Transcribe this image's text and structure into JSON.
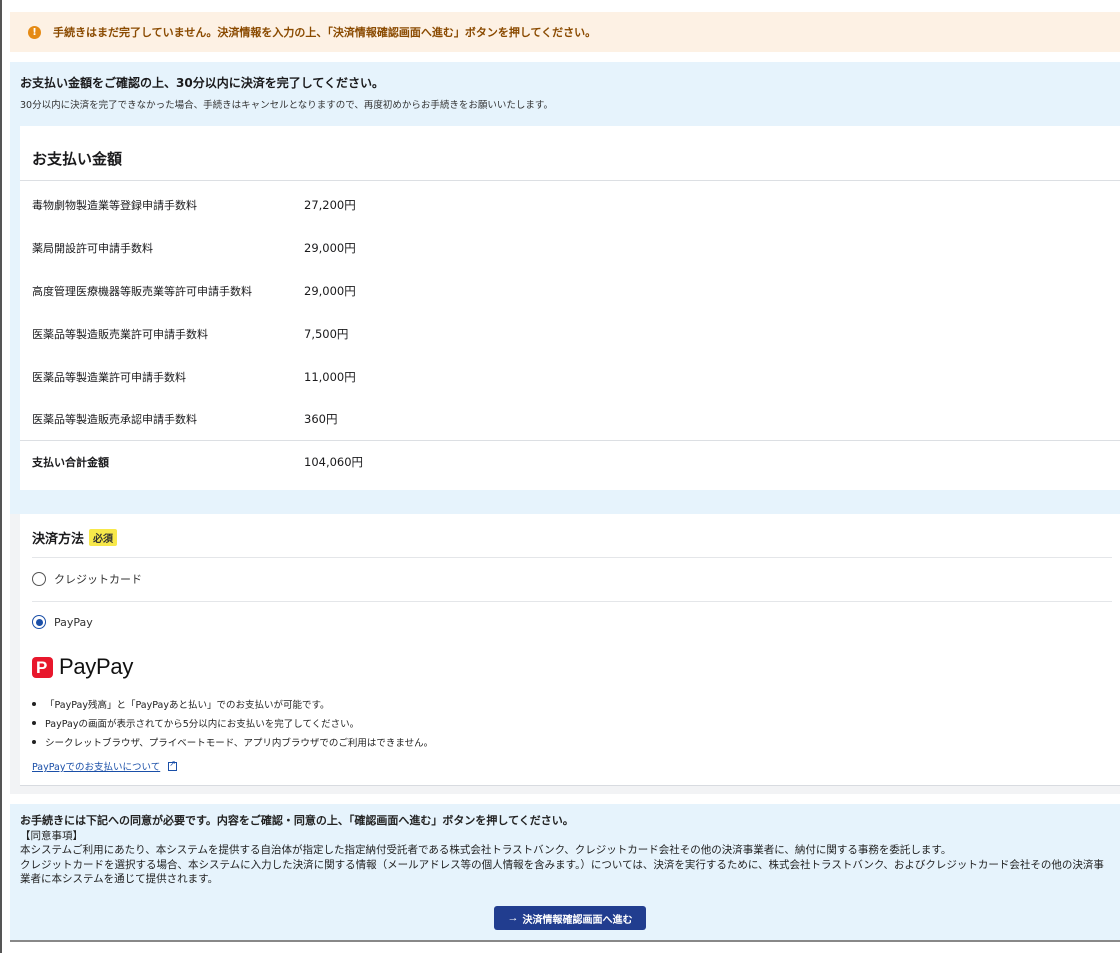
{
  "alert": {
    "icon": "exclamation-icon",
    "text": "手続きはまだ完了していません。決済情報を入力の上、「決済情報確認画面へ進む」ボタンを押してください。"
  },
  "notice": {
    "heading": "お支払い金額をご確認の上、30分以内に決済を完了してください。",
    "sub": "30分以内に決済を完了できなかった場合、手続きはキャンセルとなりますので、再度初めからお手続きをお願いいたします。"
  },
  "payment": {
    "title": "お支払い金額",
    "items": [
      {
        "name": "毒物劇物製造業等登録申請手数料",
        "amount": "27,200円"
      },
      {
        "name": "薬局開設許可申請手数料",
        "amount": "29,000円"
      },
      {
        "name": "高度管理医療機器等販売業等許可申請手数料",
        "amount": "29,000円"
      },
      {
        "name": "医薬品等製造販売業許可申請手数料",
        "amount": "7,500円"
      },
      {
        "name": "医薬品等製造業許可申請手数料",
        "amount": "11,000円"
      },
      {
        "name": "医薬品等製造販売承認申請手数料",
        "amount": "360円"
      }
    ],
    "total_label": "支払い合計金額",
    "total_amount": "104,060円"
  },
  "method": {
    "title": "決済方法",
    "required_badge": "必須",
    "options": [
      {
        "label": "クレジットカード",
        "checked": false
      },
      {
        "label": "PayPay",
        "checked": true
      }
    ],
    "logo_text": "PayPay",
    "bullets": [
      "「PayPay残高」と「PayPayあと払い」でのお支払いが可能です。",
      "PayPayの画面が表示されてから5分以内にお支払いを完了してください。",
      "シークレットブラウザ、プライベートモード、アプリ内ブラウザでのご利用はできません。"
    ],
    "link_text": "PayPayでのお支払いについて"
  },
  "agreement": {
    "heading": "お手続きには下記への同意が必要です。内容をご確認・同意の上、「確認画面へ進む」ボタンを押してください。",
    "label": "【同意事項】",
    "line1": "本システムご利用にあたり、本システムを提供する自治体が指定した指定納付受託者である株式会社トラストバンク、クレジットカード会社その他の決済事業者に、納付に関する事務を委託します。",
    "line2": "クレジットカードを選択する場合、本システムに入力した決済に関する情報（メールアドレス等の個人情報を含みます。）については、決済を実行するために、株式会社トラストバンク、およびクレジットカード会社その他の決済事業者に本システムを通じて提供されます。"
  },
  "proceed_button": {
    "label": "決済情報確認画面へ進む"
  },
  "colors": {
    "alert_bg": "#fdf1e4",
    "notice_bg": "#e6f3fc",
    "primary": "#213d8f",
    "paypay_red": "#e8172c",
    "badge_yellow": "#f7e84a"
  }
}
